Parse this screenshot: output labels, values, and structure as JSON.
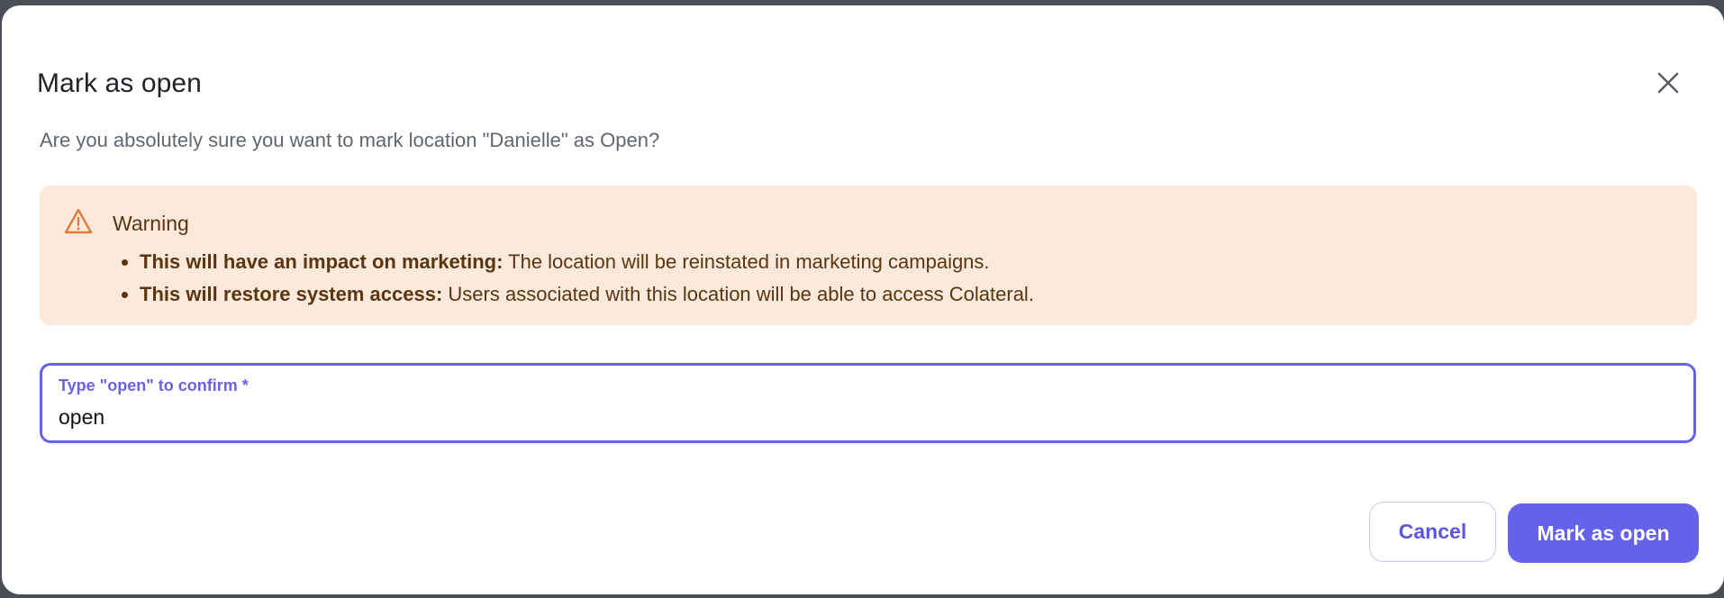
{
  "dialog": {
    "title": "Mark as open",
    "close_icon": "close-icon",
    "message": "Are you absolutely sure you want to mark location \"Danielle\" as Open?"
  },
  "warning": {
    "icon": "warning-triangle-icon",
    "title": "Warning",
    "items": [
      {
        "heading": "This will have an impact on marketing:",
        "text": " The location will be reinstated in marketing campaigns."
      },
      {
        "heading": "This will restore system access:",
        "text": " Users associated with this location will be able to access Colateral."
      }
    ]
  },
  "confirm_field": {
    "label": "Type \"open\" to confirm *",
    "value": "open"
  },
  "actions": {
    "cancel_label": "Cancel",
    "confirm_label": "Mark as open"
  },
  "colors": {
    "accent": "#6462e8",
    "warning_bg": "#fbeadb",
    "warning_text": "#5a3510",
    "warning_icon": "#e07b39"
  }
}
